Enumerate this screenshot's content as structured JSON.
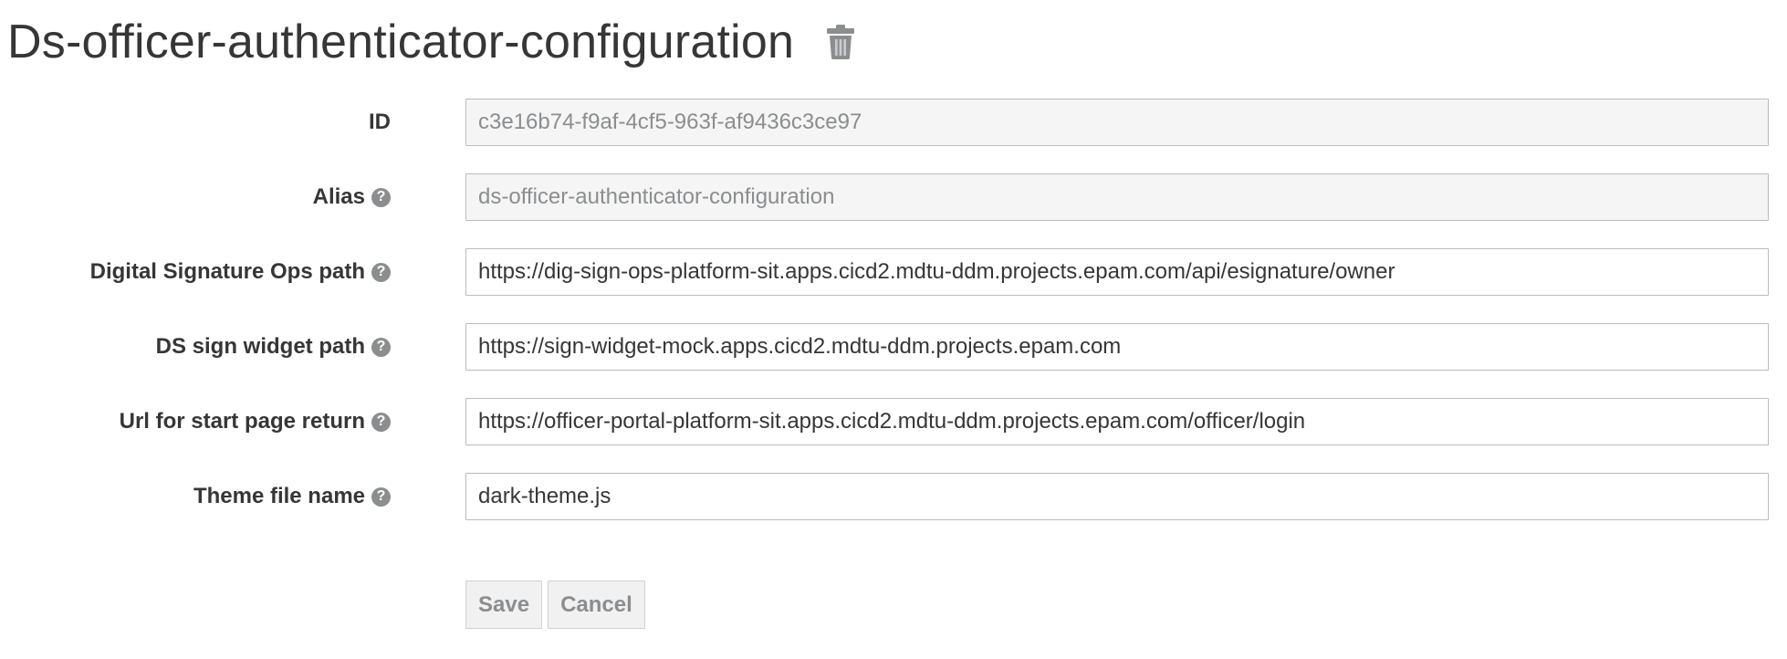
{
  "header": {
    "title": "Ds-officer-authenticator-configuration",
    "delete_icon": "trash-icon"
  },
  "form": {
    "fields": [
      {
        "label": "ID",
        "value": "c3e16b74-f9af-4cf5-963f-af9436c3ce97",
        "readonly": true,
        "help": false
      },
      {
        "label": "Alias",
        "value": "ds-officer-authenticator-configuration",
        "readonly": true,
        "help": true
      },
      {
        "label": "Digital Signature Ops path",
        "value": "https://dig-sign-ops-platform-sit.apps.cicd2.mdtu-ddm.projects.epam.com/api/esignature/owner",
        "readonly": false,
        "help": true
      },
      {
        "label": "DS sign widget path",
        "value": "https://sign-widget-mock.apps.cicd2.mdtu-ddm.projects.epam.com",
        "readonly": false,
        "help": true
      },
      {
        "label": "Url for start page return",
        "value": "https://officer-portal-platform-sit.apps.cicd2.mdtu-ddm.projects.epam.com/officer/login",
        "readonly": false,
        "help": true
      },
      {
        "label": "Theme file name",
        "value": "dark-theme.js",
        "readonly": false,
        "help": true
      }
    ],
    "help_glyph": "?"
  },
  "buttons": {
    "save_label": "Save",
    "cancel_label": "Cancel"
  },
  "colors": {
    "text": "#363636",
    "muted": "#8b8d8f",
    "readonly_bg": "#f5f5f5",
    "border": "#bbbbbb"
  }
}
